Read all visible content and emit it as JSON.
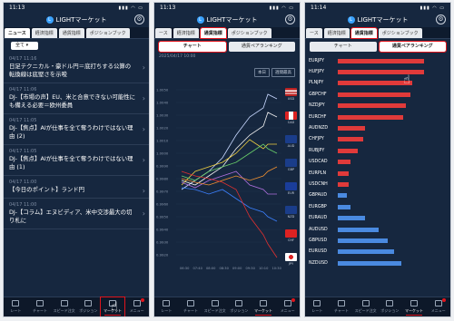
{
  "app_title": "LIGHTマーケット",
  "colors": {
    "up": "#e03a3a",
    "down": "#4a8ae0",
    "accent": "#e0141c",
    "bg": "#16273f"
  },
  "screen1": {
    "time": "11:13",
    "tabs": [
      "ニュース",
      "経済指標",
      "通貨指標",
      "ポジションブック"
    ],
    "filter": "全て ▾",
    "news": [
      {
        "time": "04/17 11:16",
        "headline": "日足テクニカル・豪ドル円＝底打ちする公算の転換線は底堅さを示唆"
      },
      {
        "time": "04/17 11:06",
        "headline": "DJ-【市場の声】EU、米と合意できない可能性にも備える必要＝欧州委員"
      },
      {
        "time": "04/17 11:05",
        "headline": "DJ-【焦点】AIが仕事を全て奪うわけではない理由 (2)"
      },
      {
        "time": "04/17 11:05",
        "headline": "DJ-【焦点】AIが仕事を全て奪うわけではない理由 (1)"
      },
      {
        "time": "04/17 11:00",
        "headline": "【今日のポイント】ランド円"
      },
      {
        "time": "04/17 11:00",
        "headline": "DJ-【コラム】エヌビディア、米中交渉最大の切り札に"
      }
    ]
  },
  "screen2": {
    "time": "11:13",
    "tabs": [
      "ース",
      "経済指標",
      "通貨指標",
      "ポジションブック"
    ],
    "subtabs": [
      "チャート",
      "通貨ペアランキング"
    ],
    "date": "2025/04/17 10:00",
    "periods": [
      "本日",
      "週間最高"
    ],
    "yticks": [
      "1.0050",
      "1.0040",
      "1.0030",
      "1.0020",
      "1.0010",
      "1.0000",
      "0.9990",
      "0.9980",
      "0.9970",
      "0.9960",
      "0.9950",
      "0.9940",
      "0.9930",
      "0.9920"
    ],
    "xticks": [
      "06:30",
      "07:40",
      "08:00",
      "08:30",
      "09:00",
      "09:30",
      "10:10",
      "10:30"
    ],
    "currencies": [
      "USD",
      "CAD",
      "AUD",
      "GBP",
      "EUR",
      "NZD",
      "CHF",
      "JPY"
    ]
  },
  "screen3": {
    "time": "11:14",
    "tabs": [
      "ース",
      "経済指標",
      "通貨指標",
      "ポジションブック"
    ],
    "subtabs": [
      "チャート",
      "通貨ペアランキング"
    ],
    "pairs": [
      {
        "name": "EURJPY",
        "value": 0.95,
        "dir": "up"
      },
      {
        "name": "HUFJPY",
        "value": 0.95,
        "dir": "up"
      },
      {
        "name": "PLNJPY",
        "value": 0.82,
        "dir": "up"
      },
      {
        "name": "GBPCHF",
        "value": 0.8,
        "dir": "up"
      },
      {
        "name": "NZDJPY",
        "value": 0.75,
        "dir": "up"
      },
      {
        "name": "EURCHF",
        "value": 0.72,
        "dir": "up"
      },
      {
        "name": "AUDNZD",
        "value": 0.3,
        "dir": "up"
      },
      {
        "name": "CHFJPY",
        "value": 0.28,
        "dir": "up"
      },
      {
        "name": "RUBJPY",
        "value": 0.22,
        "dir": "up"
      },
      {
        "name": "USDCAD",
        "value": 0.14,
        "dir": "up"
      },
      {
        "name": "EURPLN",
        "value": 0.12,
        "dir": "up"
      },
      {
        "name": "USDCNH",
        "value": 0.12,
        "dir": "up"
      },
      {
        "name": "GBPAUD",
        "value": 0.1,
        "dir": "down"
      },
      {
        "name": "EURGBP",
        "value": 0.14,
        "dir": "down"
      },
      {
        "name": "EURAUD",
        "value": 0.3,
        "dir": "down"
      },
      {
        "name": "AUDUSD",
        "value": 0.45,
        "dir": "down"
      },
      {
        "name": "GBPUSD",
        "value": 0.55,
        "dir": "down"
      },
      {
        "name": "EURUSD",
        "value": 0.62,
        "dir": "down"
      },
      {
        "name": "NZDUSD",
        "value": 0.7,
        "dir": "down"
      }
    ]
  },
  "nav": [
    "レート",
    "チャート",
    "スピード注文",
    "ポジション",
    "マーケット",
    "メニュー"
  ]
}
